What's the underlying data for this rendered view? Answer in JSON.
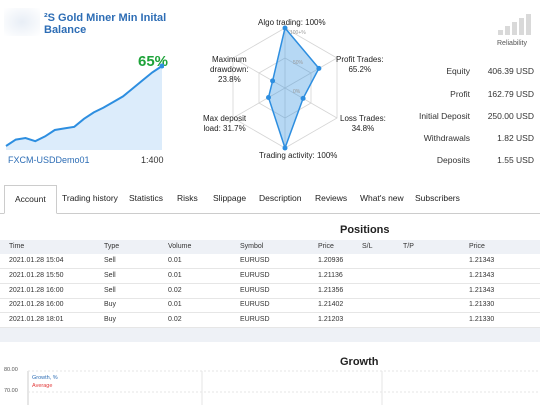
{
  "header": {
    "title_line1": "²S Gold Miner Min Inital",
    "title_line2": "Balance",
    "growth_pct": "65%",
    "account": "FXCM-USDDemo01",
    "leverage": "1:400"
  },
  "radar": {
    "labels": {
      "algo": "Algo trading: 100%",
      "profit_trades_1": "Profit Trades:",
      "profit_trades_2": "65.2%",
      "loss_trades_1": "Loss Trades:",
      "loss_trades_2": "34.8%",
      "activity": "Trading activity: 100%",
      "max_deposit_1": "Max deposit",
      "max_deposit_2": "load: 31.7%",
      "max_dd_1": "Maximum",
      "max_dd_2": "drawdown:",
      "max_dd_3": "23.8%"
    },
    "rings": {
      "r100": "100+%",
      "r50": "50%",
      "r0": "0%"
    },
    "values": {
      "algo": 1.0,
      "profit": 0.652,
      "loss": 0.348,
      "activity": 1.0,
      "deposit": 0.317,
      "drawdown": 0.238
    }
  },
  "reliability": {
    "label": "Reliability",
    "level": 1
  },
  "stats": [
    {
      "label": "Equity",
      "value": "406.39 USD"
    },
    {
      "label": "Profit",
      "value": "162.79 USD"
    },
    {
      "label": "Initial Deposit",
      "value": "250.00 USD"
    },
    {
      "label": "Withdrawals",
      "value": "1.82 USD"
    },
    {
      "label": "Deposits",
      "value": "1.55 USD"
    }
  ],
  "tabs": [
    "Account",
    "Trading history",
    "Statistics",
    "Risks",
    "Slippage",
    "Description",
    "Reviews",
    "What's new",
    "Subscribers"
  ],
  "positions": {
    "title": "Positions",
    "headers": [
      "Time",
      "Type",
      "Volume",
      "Symbol",
      "Price",
      "S/L",
      "T/P",
      "Price"
    ],
    "rows": [
      [
        "2021.01.28 15:04",
        "Sell",
        "0.01",
        "EURUSD",
        "1.20936",
        "",
        "",
        "1.21343"
      ],
      [
        "2021.01.28 15:50",
        "Sell",
        "0.01",
        "EURUSD",
        "1.21136",
        "",
        "",
        "1.21343"
      ],
      [
        "2021.01.28 16:00",
        "Sell",
        "0.02",
        "EURUSD",
        "1.21356",
        "",
        "",
        "1.21343"
      ],
      [
        "2021.01.28 16:00",
        "Buy",
        "0.01",
        "EURUSD",
        "1.21402",
        "",
        "",
        "1.21330"
      ],
      [
        "2021.01.28 18:01",
        "Buy",
        "0.02",
        "EURUSD",
        "1.21203",
        "",
        "",
        "1.21330"
      ]
    ]
  },
  "growth": {
    "title": "Growth",
    "y_ticks": [
      "80.00",
      "70.00"
    ],
    "legend": [
      {
        "name": "Growth, %",
        "color": "#2d6db5"
      },
      {
        "name": "Average",
        "color": "#e23b3b"
      }
    ]
  },
  "colors": {
    "accent": "#2d6db5",
    "growth": "#1ea33a",
    "area": "#dcecfb",
    "line": "#2d8ee0"
  },
  "mini_chart": {
    "points": [
      0.0,
      0.08,
      0.1,
      0.06,
      0.12,
      0.2,
      0.22,
      0.24,
      0.34,
      0.42,
      0.48,
      0.55,
      0.62,
      0.72,
      0.82,
      0.92,
      1.0
    ]
  }
}
